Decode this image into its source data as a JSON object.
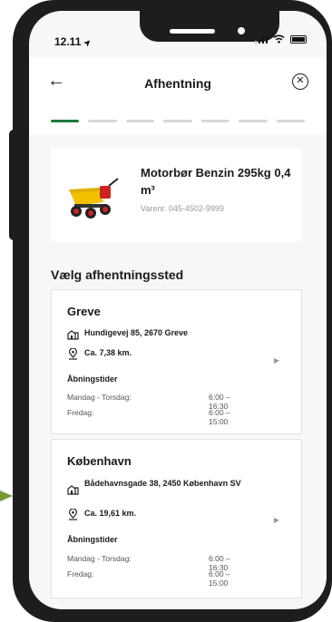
{
  "status_bar": {
    "time": "12.11",
    "location_glyph": "➤"
  },
  "header": {
    "title": "Afhentning",
    "back_glyph": "←",
    "close_glyph": "✕"
  },
  "stepper": {
    "total_steps": 7,
    "active_step": 1
  },
  "product": {
    "name": "Motorbør Benzin 295kg 0,4 m³",
    "sku": "Varenr. 045-4502-9999"
  },
  "section_title": "Vælg afhentningssted",
  "locations": [
    {
      "name": "Greve",
      "address": "Hundigevej 85, 2670 Greve",
      "distance": "Ca. 7,38 km.",
      "hours_title": "Åbningstider",
      "hours": [
        {
          "days": "Mandag - Torsdag:",
          "time": "6:00 – 16:30"
        },
        {
          "days": "Fredag:",
          "time": "6:00 – 15:00"
        }
      ]
    },
    {
      "name": "København",
      "address": "Bådehavnsgade 38, 2450 København SV",
      "distance": "Ca. 19,61 km.",
      "hours_title": "Åbningstider",
      "hours": [
        {
          "days": "Mandag - Torsdag:",
          "time": "6:00 – 16:30"
        },
        {
          "days": "Fredag:",
          "time": "6:00 – 15:00"
        }
      ]
    }
  ],
  "colors": {
    "accent": "#1e7a3c",
    "frame": "#1d1d1d",
    "pointer": "#7a9a3a"
  }
}
